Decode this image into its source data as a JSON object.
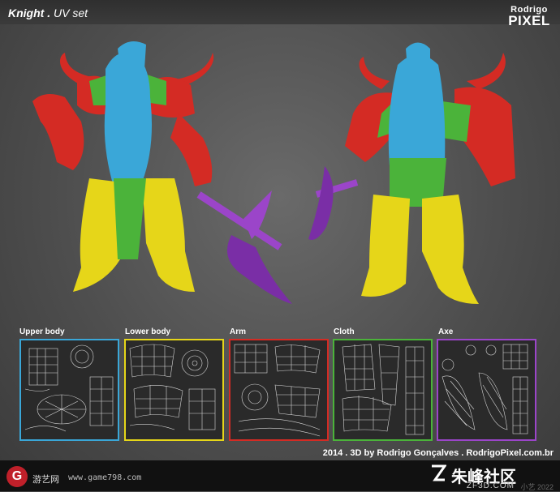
{
  "header": {
    "title_bold": "Knight .",
    "title_rest": "UV set",
    "logo_line1": "Rodrigo",
    "logo_line2": "PIXEL"
  },
  "uv_sets": [
    {
      "label": "Upper body",
      "color": "#3aa7d8"
    },
    {
      "label": "Lower body",
      "color": "#e6d619"
    },
    {
      "label": "Arm",
      "color": "#d42b24"
    },
    {
      "label": "Cloth",
      "color": "#4bb33a"
    },
    {
      "label": "Axe",
      "color": "#9b45c9"
    }
  ],
  "credit": "2014 . 3D by Rodrigo Gonçalves . RodrigoPixel.com.br",
  "footer": {
    "left_logo": "G",
    "site_name": "游艺网",
    "site_url": "www.game798.com",
    "right_logo": "朱峰社区",
    "right_sub": "ZF3D.COM",
    "watermark": "小艺 2022"
  },
  "colors": {
    "upper_body": "#3aa7d8",
    "lower_body": "#e6d619",
    "arm": "#d42b24",
    "cloth": "#4bb33a",
    "axe": "#9b45c9"
  }
}
